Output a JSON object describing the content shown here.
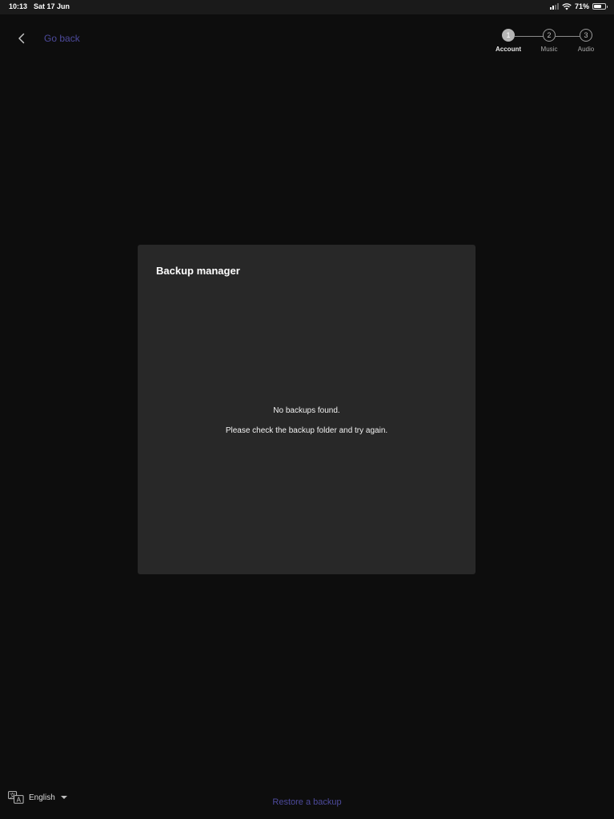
{
  "status_bar": {
    "time": "10:13",
    "date": "Sat 17 Jun",
    "battery": "71%",
    "battery_level": 0.71
  },
  "header": {
    "back_label": "Go back"
  },
  "stepper": {
    "steps": [
      {
        "number": "1",
        "label": "Account",
        "active": true
      },
      {
        "number": "2",
        "label": "Music",
        "active": false
      },
      {
        "number": "3",
        "label": "Audio",
        "active": false
      }
    ]
  },
  "dialog": {
    "title": "Backup manager",
    "message": "No backups found.",
    "submessage": "Please check the backup folder and try again."
  },
  "footer": {
    "language": "English",
    "restore_label": "Restore a backup"
  },
  "colors": {
    "background": "#0d0d0d",
    "dialog": "#282828",
    "link": "#4d4a9c"
  },
  "icons": {
    "back": "chevron-left-icon",
    "language": "translate-icon",
    "dropdown": "caret-down-icon"
  }
}
